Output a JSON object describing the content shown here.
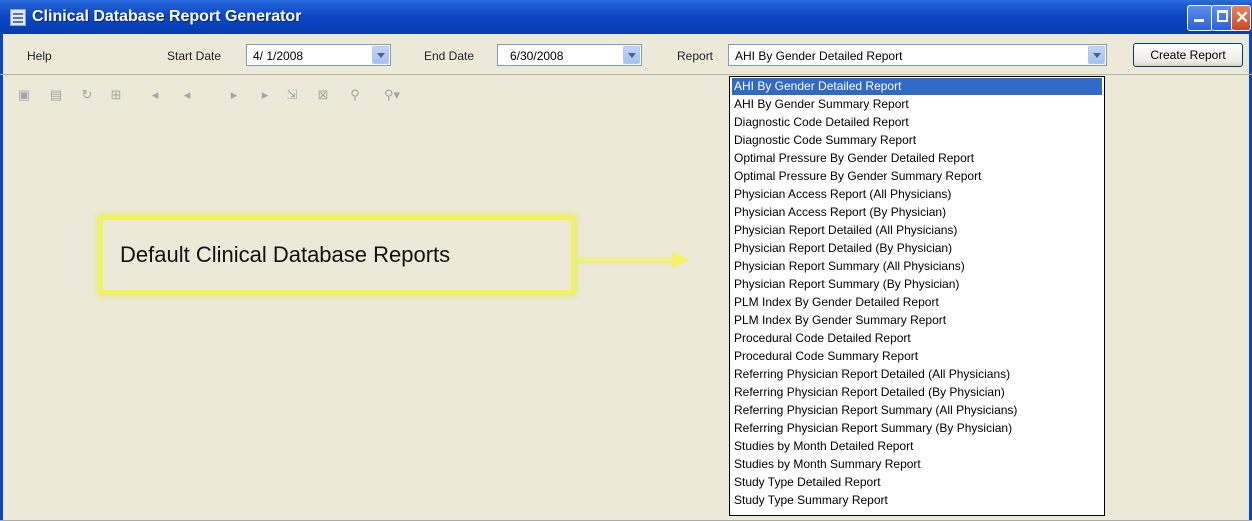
{
  "window": {
    "title": "Clinical Database Report Generator"
  },
  "toolbar": {
    "help_label": "Help",
    "start_date_label": "Start Date",
    "start_date_value": "4/ 1/2008",
    "end_date_label": "End Date",
    "end_date_value": "6/30/2008",
    "report_label": "Report",
    "report_value": "AHI By Gender Detailed Report",
    "create_report_label": "Create Report"
  },
  "viewer_toolbar": {
    "icons": [
      "export-icon",
      "print-icon",
      "refresh-icon",
      "tree-icon",
      "first-page-icon",
      "prev-page-icon",
      "next-page-icon",
      "last-page-icon",
      "goto-page-icon",
      "stop-icon",
      "find-icon",
      "zoom-icon"
    ]
  },
  "callout": {
    "text": "Default Clinical Database Reports"
  },
  "report_options": [
    "AHI By Gender Detailed Report",
    "AHI By Gender Summary Report",
    "Diagnostic Code Detailed Report",
    "Diagnostic Code Summary Report",
    "Optimal Pressure By Gender Detailed Report",
    "Optimal Pressure By Gender Summary Report",
    "Physician Access Report (All Physicians)",
    "Physician Access Report (By Physician)",
    "Physician Report Detailed (All Physicians)",
    "Physician Report Detailed (By Physician)",
    "Physician Report Summary (All Physicians)",
    "Physician Report Summary (By Physician)",
    "PLM Index By Gender Detailed Report",
    "PLM Index By Gender Summary Report",
    "Procedural Code Detailed Report",
    "Procedural Code Summary Report",
    "Referring Physician Report Detailed (All Physicians)",
    "Referring Physician Report Detailed (By Physician)",
    "Referring Physician Report Summary (All Physicians)",
    "Referring Physician Report Summary (By Physician)",
    "Studies by Month Detailed Report",
    "Studies by Month Summary Report",
    "Study Type Detailed Report",
    "Study Type Summary Report"
  ],
  "selected_option_index": 0,
  "colors": {
    "titlebar": "#0a46c4",
    "selection": "#316ac5",
    "callout": "#f1f35a",
    "background": "#ece9d8"
  }
}
